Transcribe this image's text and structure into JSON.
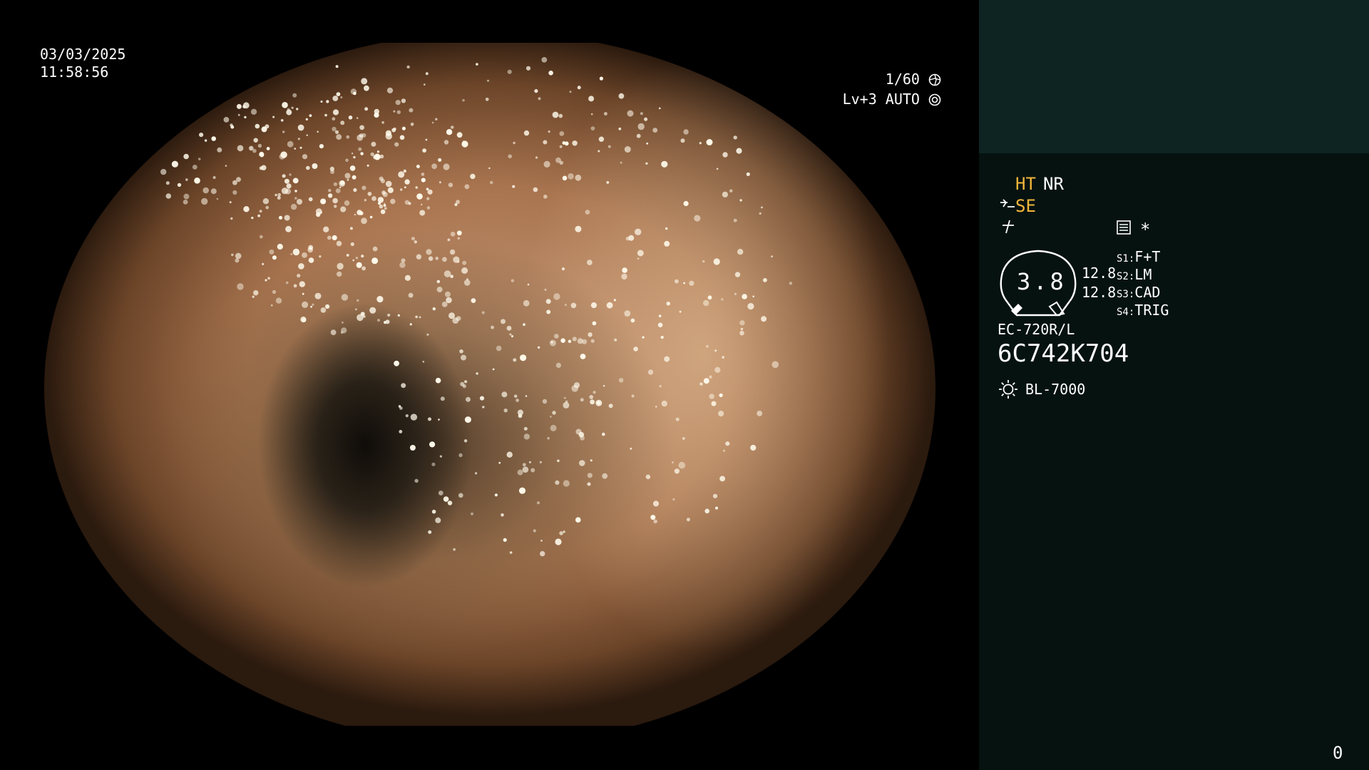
{
  "overlay": {
    "date": "03/03/2025",
    "time": "11:58:56",
    "shutter": "1/60",
    "shutter_icon": "aperture-icon",
    "level": "Lv+3 AUTO",
    "auto_icon": "iris-icon"
  },
  "panel": {
    "ht": "HT",
    "nr": "NR",
    "se": "SE",
    "se_icon": "enhance-icon",
    "freeze_icon": "freeze-icon",
    "memo_icon": "memo-icon",
    "asterisk": "*",
    "gauge_value": "3.8",
    "gauge_top": "12.8",
    "gauge_bottom": "12.8",
    "switches": [
      {
        "key": "S1:",
        "value": "F+T"
      },
      {
        "key": "S2:",
        "value": "LM"
      },
      {
        "key": "S3:",
        "value": "CAD"
      },
      {
        "key": "S4:",
        "value": "TRIG"
      }
    ],
    "scope_model": "EC-720R/L",
    "serial": "6C742K704",
    "light_icon": "light-source-icon",
    "light_source": "BL-7000",
    "counter": "0"
  },
  "colors": {
    "accent": "#f2b63a",
    "panel_bg": "#051210",
    "panel_top_bg": "#0e2422"
  }
}
